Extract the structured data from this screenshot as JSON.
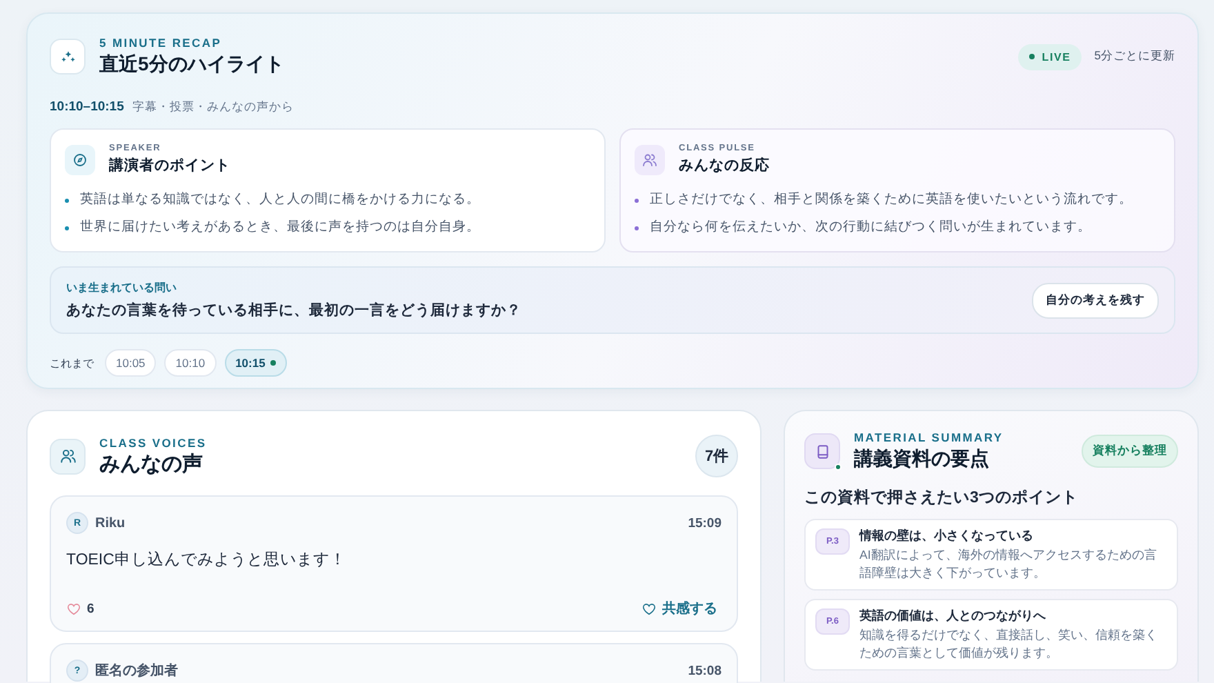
{
  "recap": {
    "eyebrow": "5 MINUTE RECAP",
    "title": "直近5分のハイライト",
    "live_badge": "LIVE",
    "update_note": "5分ごとに更新",
    "time_range": "10:10–10:15",
    "sources": "字幕・投票・みんなの声から",
    "cards": [
      {
        "kind": "speaker",
        "eyebrow": "SPEAKER",
        "title": "講演者のポイント",
        "bullets": [
          "英語は単なる知識ではなく、人と人の間に橋をかける力になる。",
          "世界に届けたい考えがあるとき、最後に声を持つのは自分自身。"
        ]
      },
      {
        "kind": "pulse",
        "eyebrow": "CLASS PULSE",
        "title": "みんなの反応",
        "bullets": [
          "正しさだけでなく、相手と関係を築くために英語を使いたいという流れです。",
          "自分なら何を伝えたいか、次の行動に結びつく問いが生まれています。"
        ]
      }
    ],
    "question": {
      "label": "いま生まれている問い",
      "text": "あなたの言葉を待っている相手に、最初の一言をどう届けますか？",
      "button": "自分の考えを残す"
    },
    "timeline": {
      "label": "これまで",
      "chips": [
        {
          "label": "10:05",
          "selected": false
        },
        {
          "label": "10:10",
          "selected": false
        },
        {
          "label": "10:15",
          "selected": true
        }
      ]
    }
  },
  "voices": {
    "eyebrow": "CLASS VOICES",
    "title": "みんなの声",
    "count": "7件",
    "items": [
      {
        "avatar": "R",
        "name": "Riku",
        "time": "15:09",
        "text": "TOEIC申し込んでみようと思います！",
        "likes": "6",
        "action": "共感する"
      },
      {
        "avatar": "?",
        "name": "匿名の参加者",
        "time": "15:08"
      }
    ]
  },
  "material": {
    "eyebrow": "MATERIAL SUMMARY",
    "title": "講義資料の要点",
    "badge": "資料から整理",
    "subtitle": "この資料で押さえたい3つのポイント",
    "points": [
      {
        "page": "P.3",
        "title": "情報の壁は、小さくなっている",
        "body": "AI翻訳によって、海外の情報へアクセスするための言語障壁は大きく下がっています。"
      },
      {
        "page": "P.6",
        "title": "英語の価値は、人とのつながりへ",
        "body": "知識を得るだけでなく、直接話し、笑い、信頼を築くための言葉として価値が残ります。"
      }
    ]
  }
}
